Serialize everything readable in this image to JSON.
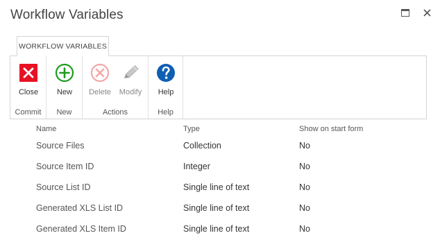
{
  "window": {
    "title": "Workflow Variables",
    "maximize_icon": "maximize-icon",
    "close_icon": "close-icon"
  },
  "ribbon": {
    "tab_label": "WORKFLOW VARIABLES",
    "groups": [
      {
        "label": "Commit",
        "buttons": [
          {
            "label": "Close",
            "icon": "close-x-icon",
            "color": "#e81123",
            "enabled": true
          }
        ]
      },
      {
        "label": "New",
        "buttons": [
          {
            "label": "New",
            "icon": "add-circle-icon",
            "color": "#1e9b1e",
            "enabled": true
          }
        ]
      },
      {
        "label": "Actions",
        "buttons": [
          {
            "label": "Delete",
            "icon": "delete-circle-icon",
            "color": "#f2a7a7",
            "enabled": false
          },
          {
            "label": "Modify",
            "icon": "pencil-icon",
            "color": "#b5b5b5",
            "enabled": false
          }
        ]
      },
      {
        "label": "Help",
        "buttons": [
          {
            "label": "Help",
            "icon": "help-icon",
            "color": "#0f5fb3",
            "enabled": true
          }
        ]
      }
    ]
  },
  "table": {
    "headers": {
      "name": "Name",
      "type": "Type",
      "show": "Show on start form"
    },
    "rows": [
      {
        "name": "Source Files",
        "type": "Collection",
        "show": "No"
      },
      {
        "name": "Source Item ID",
        "type": "Integer",
        "show": "No"
      },
      {
        "name": "Source List ID",
        "type": "Single line of text",
        "show": "No"
      },
      {
        "name": "Generated XLS List ID",
        "type": "Single line of text",
        "show": "No"
      },
      {
        "name": "Generated XLS Item ID",
        "type": "Single line of text",
        "show": "No"
      }
    ]
  }
}
